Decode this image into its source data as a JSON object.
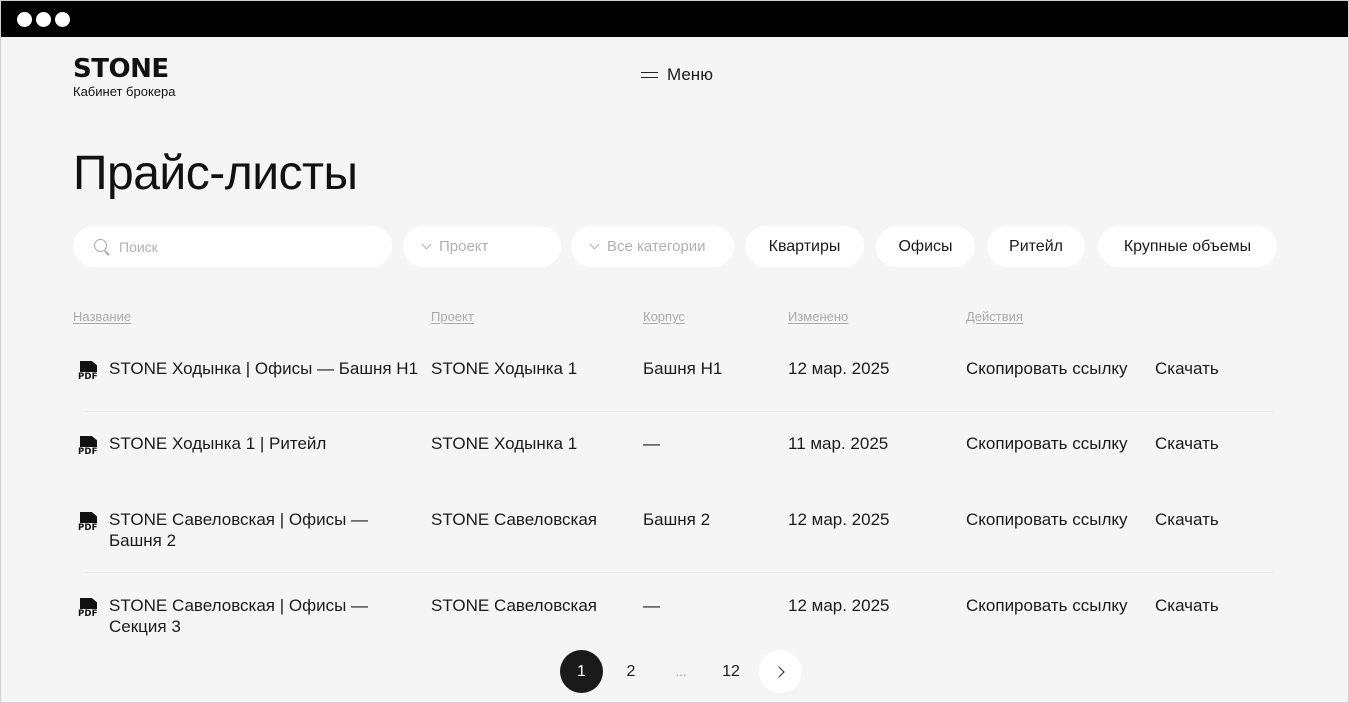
{
  "window": {
    "title_bar_dots": 3
  },
  "header": {
    "logo_word": "STONE",
    "logo_subtitle": "Кабинет брокера",
    "menu_label": "Меню"
  },
  "page_title": "Прайс-листы",
  "filters": {
    "search_placeholder": "Поиск",
    "search_value": "",
    "project_select": "Проект",
    "category_select": "Все категории",
    "chips": [
      "Квартиры",
      "Офисы",
      "Ритейл",
      "Крупные объемы"
    ]
  },
  "table": {
    "headers": {
      "name": "Название",
      "project": "Проект",
      "building": "Корпус",
      "modified": "Изменено",
      "actions": "Действия"
    },
    "file_badge": "PDF",
    "rows": [
      {
        "name": "STONE Ходынка | Офисы — Башня Н1",
        "project": "STONE Ходынка 1",
        "building": "Башня Н1",
        "modified": "12 мар. 2025",
        "copy_link": "Скопировать ссылку",
        "download": "Скачать"
      },
      {
        "name": "STONE Ходынка 1 | Ритейл",
        "project": "STONE Ходынка 1",
        "building": "—",
        "modified": "11 мар. 2025",
        "copy_link": "Скопировать ссылку",
        "download": "Скачать"
      },
      {
        "name": "STONE Савеловская | Офисы — Башня 2",
        "project": "STONE Савеловская",
        "building": "Башня 2",
        "modified": "12 мар. 2025",
        "copy_link": "Скопировать ссылку",
        "download": "Скачать"
      },
      {
        "name": "STONE Савеловская | Офисы — Секция 3",
        "project": "STONE Савеловская",
        "building": "—",
        "modified": "12 мар. 2025",
        "copy_link": "Скопировать ссылку",
        "download": "Скачать"
      }
    ]
  },
  "pagination": {
    "current": "1",
    "pages": [
      "1",
      "2",
      "...",
      "12"
    ],
    "next_icon": "chevron-right-icon"
  },
  "colors": {
    "background": "#f5f5f5",
    "surface": "#ffffff",
    "text": "#1a1a1a",
    "muted": "#aaaaaa",
    "active_page": "#1a1a1a",
    "title_bar": "#000000"
  }
}
